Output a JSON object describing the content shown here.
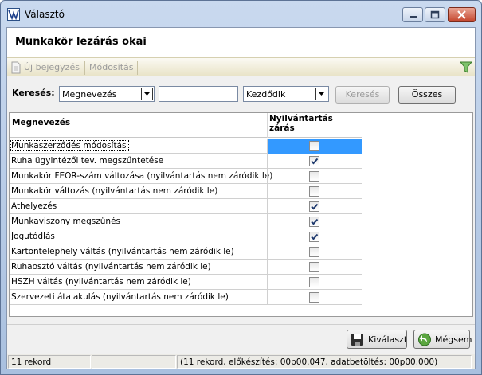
{
  "window": {
    "title": "Választó"
  },
  "header": {
    "title": "Munkakör lezárás okai"
  },
  "toolbar": {
    "new_label": "Új bejegyzés",
    "edit_label": "Módosítás"
  },
  "search": {
    "label": "Keresés:",
    "field_value": "Megnevezés",
    "text_value": "",
    "mode_value": "Kezdődik",
    "search_button": "Keresés",
    "all_button": "Összes"
  },
  "grid": {
    "columns": [
      "Megnevezés",
      "Nyilvántartás zárás"
    ],
    "rows": [
      {
        "name": "Munkaszerződés módosítás",
        "checked": false,
        "selected": true
      },
      {
        "name": "Ruha ügyintézői tev. megszűntetése",
        "checked": true,
        "selected": false
      },
      {
        "name": "Munkakör FEOR-szám változása (nyilvántartás nem záródik le)",
        "checked": false,
        "selected": false
      },
      {
        "name": "Munkakör változás (nyilvántartás nem záródik le)",
        "checked": false,
        "selected": false
      },
      {
        "name": "Áthelyezés",
        "checked": true,
        "selected": false
      },
      {
        "name": "Munkaviszony megszűnés",
        "checked": true,
        "selected": false
      },
      {
        "name": "Jogutódlás",
        "checked": true,
        "selected": false
      },
      {
        "name": "Kartontelephely váltás (nyilvántartás nem záródik le)",
        "checked": false,
        "selected": false
      },
      {
        "name": "Ruhaosztó váltás (nyilvántartás nem záródik le)",
        "checked": false,
        "selected": false
      },
      {
        "name": "HSZH váltás (nyilvántartás nem záródik le)",
        "checked": false,
        "selected": false
      },
      {
        "name": "Szervezeti átalakulás (nyilvántartás nem záródik le)",
        "checked": false,
        "selected": false
      }
    ]
  },
  "actions": {
    "select_label": "Kiválaszt",
    "cancel_label": "Mégsem"
  },
  "status": {
    "records": "11 rekord",
    "middle": "",
    "detail": "(11 rekord, előkészítés: 00p00.047, adatbetöltés: 00p00.000)"
  },
  "colors": {
    "selection": "#3399ff",
    "toolbar_bg": "#e9e4c8",
    "title_bar": "#b9cde8"
  }
}
